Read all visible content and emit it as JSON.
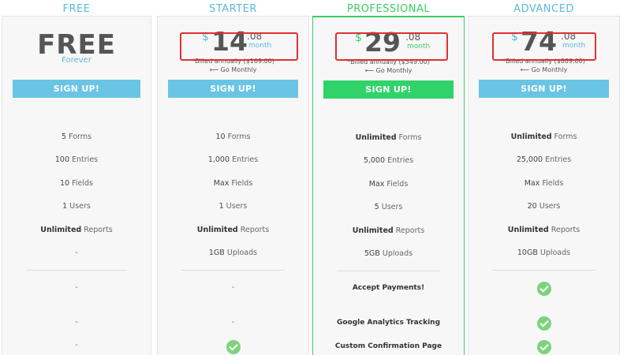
{
  "plans": {
    "free": {
      "title": "FREE",
      "big": "FREE",
      "sub": "Forever",
      "signup": "SIGN UP!",
      "forms_num": "5",
      "forms_label": "Forms",
      "entries_num": "100",
      "entries_label": "Entries",
      "fields_num": "10",
      "fields_label": "Fields",
      "users_num": "1",
      "users_label": "Users",
      "reports_num": "Unlimited",
      "reports_label": "Reports",
      "uploads": "-",
      "payments": "-",
      "analytics": "-",
      "confirmation": "-"
    },
    "starter": {
      "title": "STARTER",
      "currency": "$",
      "price_whole": "14",
      "price_cents": ".08",
      "period": "month",
      "billed": "*Billed annually ($169.00)",
      "monthly": "⟵ Go Monthly",
      "signup": "SIGN UP!",
      "forms_num": "10",
      "forms_label": "Forms",
      "entries_num": "1,000",
      "entries_label": "Entries",
      "fields_num": "Max",
      "fields_label": "Fields",
      "users_num": "1",
      "users_label": "Users",
      "reports_num": "Unlimited",
      "reports_label": "Reports",
      "uploads_num": "1GB",
      "uploads_label": "Uploads",
      "payments": "-",
      "analytics": "-"
    },
    "professional": {
      "title": "PROFESSIONAL",
      "currency": "$",
      "price_whole": "29",
      "price_cents": ".08",
      "period": "month",
      "billed": "*Billed annually ($349.00)",
      "monthly": "⟵ Go Monthly",
      "signup": "SIGN UP!",
      "forms_num": "Unlimited",
      "forms_label": "Forms",
      "entries_num": "5,000",
      "entries_label": "Entries",
      "fields_num": "Max",
      "fields_label": "Fields",
      "users_num": "5",
      "users_label": "Users",
      "reports_num": "Unlimited",
      "reports_label": "Reports",
      "uploads_num": "5GB",
      "uploads_label": "Uploads",
      "payments": "Accept Payments!",
      "analytics": "Google Analytics Tracking",
      "confirmation": "Custom Confirmation Page"
    },
    "advanced": {
      "title": "ADVANCED",
      "currency": "$",
      "price_whole": "74",
      "price_cents": ".08",
      "period": "month",
      "billed": "*Billed annually ($889.00)",
      "monthly": "⟵ Go Monthly",
      "signup": "SIGN UP!",
      "forms_num": "Unlimited",
      "forms_label": "Forms",
      "entries_num": "25,000",
      "entries_label": "Entries",
      "fields_num": "Max",
      "fields_label": "Fields",
      "users_num": "20",
      "users_label": "Users",
      "reports_num": "Unlimited",
      "reports_label": "Reports",
      "uploads_num": "10GB",
      "uploads_label": "Uploads"
    }
  },
  "colors": {
    "accent_blue": "#5cb9dc",
    "accent_green": "#3ccc62",
    "highlight_red": "#e03030",
    "check_green": "#7dd37d"
  },
  "icons": {
    "check": "check-circle-icon"
  }
}
